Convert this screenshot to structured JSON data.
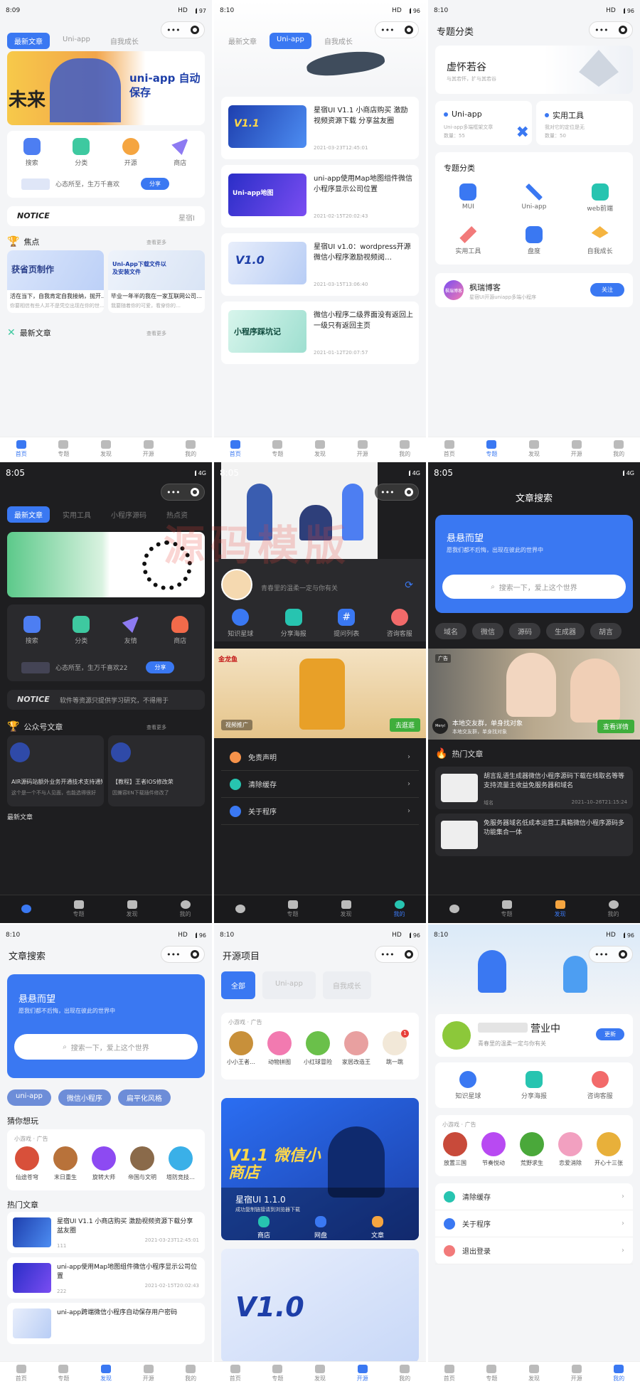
{
  "screens": {
    "s1": {
      "time": "8:09",
      "net": "HD",
      "battery": "97",
      "tabs": [
        "最新文章",
        "Uni-app",
        "自我成长"
      ],
      "banner_text": "uni-app 自动保存",
      "banner_sub": "未来",
      "icons": [
        "搜索",
        "分类",
        "开源",
        "商店"
      ],
      "share_text": "心态所至，生万千喜欢",
      "share_btn": "分享",
      "notice": "NOTICE",
      "notice_right": "星宿I",
      "sec1": "焦点",
      "more": "查看更多",
      "focus": [
        {
          "img": "获省页制作",
          "t": "活在当下，自我肯定自我接纳，抛开…",
          "s": "你要相信有些人并不是凭空出现在你的世…"
        },
        {
          "img": "Uni-App下载文件以及安装文件",
          "t": "毕业一年半的我在一家互联网公司…",
          "s": "我要随着你的可爱，看穿你的…"
        }
      ],
      "sec2": "最新文章"
    },
    "s2": {
      "time": "8:10",
      "net": "HD",
      "battery": "96",
      "tabs": [
        "最新文章",
        "Uni-app",
        "自我成长"
      ],
      "articles": [
        {
          "t": "星宿UI V1.1 小商店购买 激励视频资源下载 分享盆友圈",
          "d": "2021-03-23T12:45:01",
          "img": "V1.1"
        },
        {
          "t": "uni-app使用Map地图组件微信小程序显示公司位置",
          "d": "2021-02-15T20:02:43",
          "img": "Uni-app地图"
        },
        {
          "t": "星宿UI v1.0：wordpress开源微信小程序激励视频阅…",
          "d": "2021-03-15T13:06:40",
          "img": "V1.0"
        },
        {
          "t": "微信小程序二级界面没有返回上一级只有返回主页",
          "d": "2021-01-12T20:07:57",
          "img": "小程序踩坑记"
        }
      ]
    },
    "s3": {
      "time": "8:10",
      "net": "HD",
      "battery": "96",
      "title": "专题分类",
      "hero": "虚怀若谷",
      "hero_sub": "与其若怀，扩与其若谷",
      "cards": [
        {
          "t": "Uni-app",
          "s": "Uni-app多端框架文章",
          "n": "数量：55"
        },
        {
          "t": "实用工具",
          "s": "我对它的定位是无",
          "n": "数量：50"
        }
      ],
      "sec": "专题分类",
      "cats": [
        "MUI",
        "Uni-app",
        "web前端",
        "实用工具",
        "盘度",
        "自我成长"
      ],
      "blog": "枫瑞博客",
      "blog_sub": "星宿UI开源uniapp多端小程序",
      "blog_logo": "枫瑞博客",
      "follow": "关注"
    },
    "s4": {
      "time": "8:05",
      "net": "",
      "battery": "4G",
      "tabs": [
        "最新文章",
        "实用工具",
        "小程序源码",
        "热点资"
      ],
      "icons": [
        "搜索",
        "分类",
        "友情",
        "商店"
      ],
      "share_text": "心态所至，生万千喜欢22",
      "share_btn": "分享",
      "notice": "NOTICE",
      "notice_text": "软件等资源只提供学习研究，不得用于",
      "sec1": "公众号文章",
      "more": "查看更多",
      "focus": [
        {
          "t": "AIR源码站额外业务开通技术支持通知",
          "s": "这个是一个不与人见面，也能选得很好"
        },
        {
          "t": "【教程】王者IOS修改荣",
          "s": "因兼容EN下载插件修改了"
        }
      ],
      "sec2": "最新文章"
    },
    "s5": {
      "time": "8:05",
      "net": "",
      "battery": "4G",
      "profile_text": "青春里的温柔一定与你有关",
      "icons": [
        "知识星球",
        "分享海报",
        "提问列表",
        "咨询客服"
      ],
      "ad_label": "视频推广",
      "ad_btn": "去逛逛",
      "ad_brand": "金龙鱼",
      "menu": [
        "免责声明",
        "清除缓存",
        "关于程序"
      ]
    },
    "s6": {
      "time": "8:05",
      "net": "",
      "battery": "4G",
      "title": "文章搜索",
      "hero": "悬悬而望",
      "hero_sub": "愿我们都不后悔，出现在彼此的世界中",
      "placeholder": "搜索一下，爱上这个世界",
      "chips": [
        "域名",
        "微信",
        "源码",
        "生成器",
        "胡言"
      ],
      "ad": "广告",
      "ad_t": "本地交友群，单身找对象",
      "ad_s": "本地交友群，单身找对象",
      "ad_btn": "查看详情",
      "ad_brand": "Meryl",
      "sec": "热门文章",
      "hots": [
        {
          "t": "胡言乱语生成器微信小程序源码下载在线取名等等支持流量主收益免服务器和域名",
          "tag": "域名",
          "d": "2021–10–26T21:15:24"
        },
        {
          "t": "免服务器域名低成本运营工具箱微信小程序源码多功能集合一体",
          "tag": "",
          "d": ""
        }
      ]
    },
    "s7": {
      "time": "8:10",
      "net": "HD",
      "battery": "96",
      "title": "文章搜索",
      "hero": "悬悬而望",
      "hero_sub": "愿我们都不后悔，出现在彼此的世界中",
      "placeholder": "搜索一下，爱上这个世界",
      "chips": [
        "uni-app",
        "微信小程序",
        "扁平化风格"
      ],
      "sec1": "猜你想玩",
      "ad": "小游戏 · 广告",
      "games": [
        "仙途苍穹",
        "末日重生",
        "旋转大师",
        "帝国与文明",
        "塔防竞技…"
      ],
      "sec2": "热门文章",
      "hots": [
        {
          "t": "星宿UI V1.1 小商店购买 激励视频资源下载分享盆友圈",
          "n": "111",
          "d": "2021-03-23T12:45:01"
        },
        {
          "t": "uni-app使用Map地图组件微信小程序显示公司位置",
          "n": "222",
          "d": "2021-02-15T20:02:43"
        },
        {
          "t": "uni-app跨端微信小程序自动保存用户密码",
          "n": "",
          "d": ""
        }
      ]
    },
    "s8": {
      "time": "8:10",
      "net": "HD",
      "battery": "96",
      "title": "开源项目",
      "tabs": [
        "全部",
        "Uni-app",
        "自我成长"
      ],
      "ad": "小游戏 · 广告",
      "games": [
        "小小王者…",
        "动物拼图",
        "小红球冒险",
        "家居改造王",
        "跳一跳"
      ],
      "badge": "1",
      "proj": "星宿UI 1.1.0",
      "proj_sub": "成功复制链接请到浏览器下载",
      "proj_icons": [
        "商店",
        "网盘",
        "文章"
      ],
      "img1": "V1.1 微信小商店",
      "img2": "V1.0"
    },
    "s9": {
      "time": "8:10",
      "net": "HD",
      "battery": "96",
      "status": "营业中",
      "sub": "青春里的温柔一定与你有关",
      "btn": "更新",
      "icons": [
        "知识星球",
        "分享海报",
        "咨询客服"
      ],
      "ad": "小游戏 · 广告",
      "games": [
        "放置三国",
        "节奏悦动",
        "荒野求生",
        "恋爱消除",
        "开心十三张"
      ],
      "menu": [
        "清除缓存",
        "关于程序",
        "退出登录"
      ]
    }
  },
  "nav_light": [
    "首页",
    "专题",
    "发现",
    "开源",
    "我的"
  ],
  "nav_dark": [
    "",
    "专题",
    "发现",
    "我的"
  ],
  "watermark": "源码模版",
  "colors": {
    "accent": "#3a78f2",
    "dark": "#1e1e20"
  }
}
